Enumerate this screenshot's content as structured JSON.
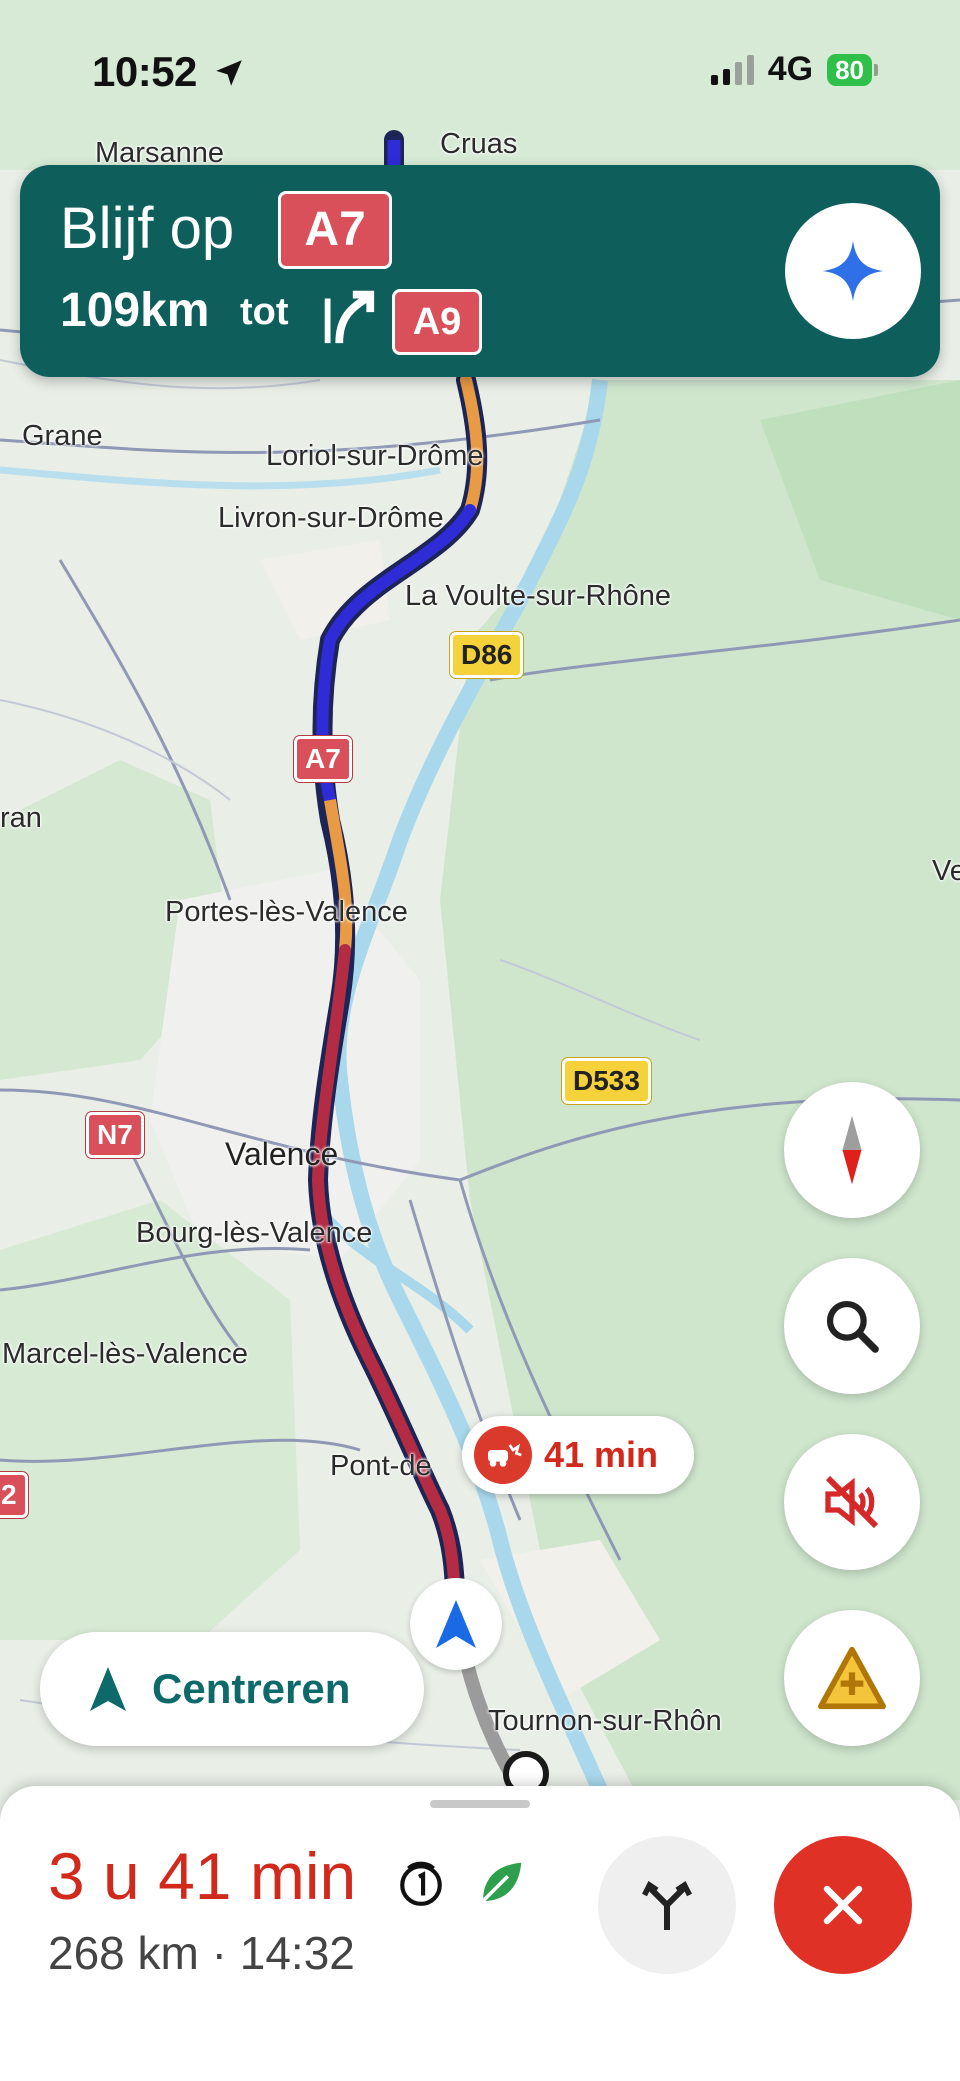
{
  "status_bar": {
    "time": "10:52",
    "network": "4G",
    "battery": "80"
  },
  "nav_banner": {
    "instruction": "Blijf op",
    "road": "A7",
    "distance": "109km",
    "tot": "tot",
    "next_road": "A9",
    "turn_icon": "fork-right-icon",
    "assistant_icon": "gemini-sparkle-icon"
  },
  "map": {
    "labels": {
      "marsanne": "Marsanne",
      "cruas": "Cruas",
      "grane": "Grane",
      "loriol": "Loriol-sur-Drôme",
      "livron": "Livron-sur-Drôme",
      "la_voulte": "La Voulte-sur-Rhône",
      "portes": "Portes-lès-Valence",
      "valence": "Valence",
      "bourg": "Bourg-lès-Valence",
      "saint_marcel": "Marcel-lès-Valence",
      "pont_de": "Pont-de",
      "tournon": "Tournon-sur-Rhôn",
      "ran": "ran",
      "ve": "Ve",
      "edge_2": "2"
    },
    "shields": {
      "d86": "D86",
      "a7": "A7",
      "d533": "D533",
      "n7": "N7"
    },
    "traffic_delay": "41 min"
  },
  "controls": {
    "compass_icon": "compass-icon",
    "search_icon": "search-icon",
    "sound_icon": "sound-off-icon",
    "report_icon": "report-incident-icon",
    "center_label": "Centreren"
  },
  "trip": {
    "duration": "3 u 41 min",
    "distance": "268 km",
    "separator": "·",
    "arrival": "14:32"
  },
  "colors": {
    "banner": "#0e5f5c",
    "route": "#2f2bd6",
    "traffic_heavy": "#b32c44",
    "traffic_medium": "#e89a45",
    "eta_red": "#d12a1c",
    "close_red": "#e03127"
  }
}
